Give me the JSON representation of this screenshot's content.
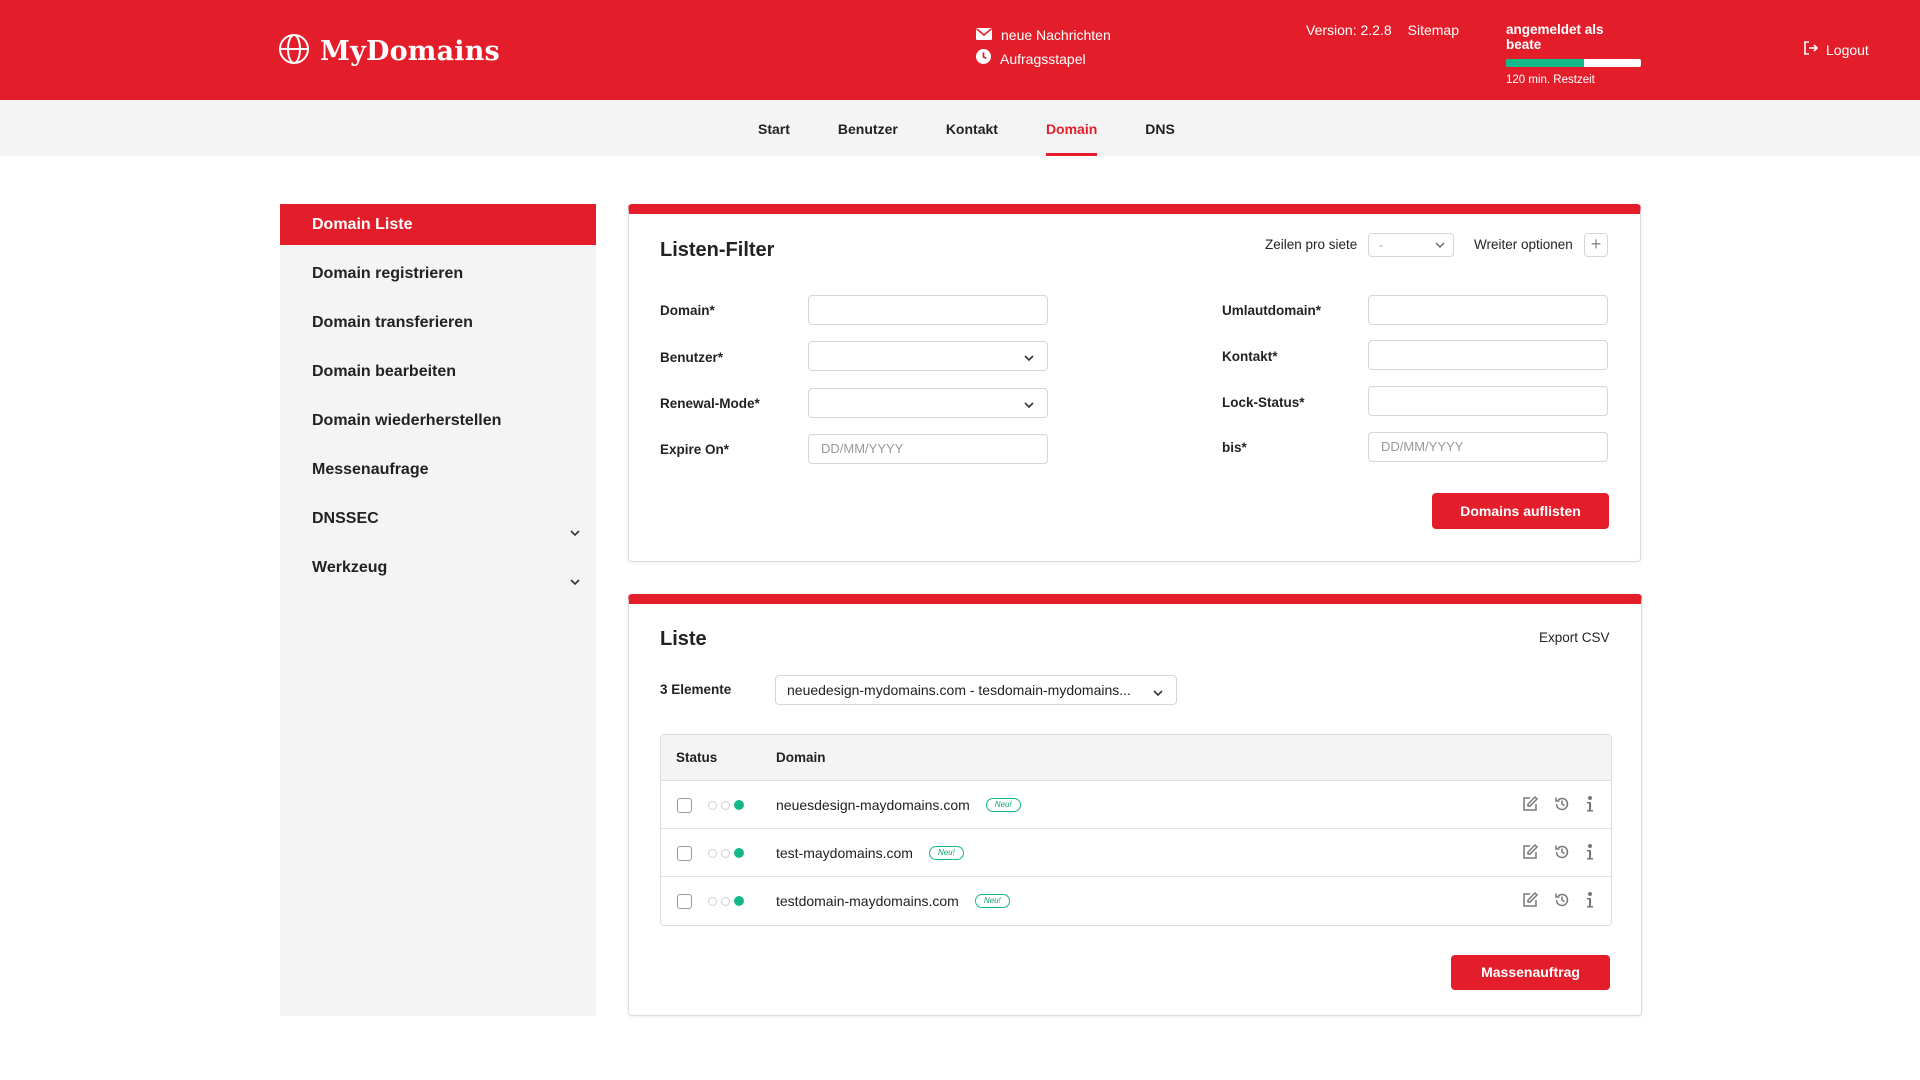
{
  "header": {
    "brand": "MyDomains",
    "links": [
      "neue Nachrichten",
      "Aufragsstapel"
    ],
    "version": "Version: 2.2.8",
    "sitemap": "Sitemap",
    "user": "angemeldet als beate",
    "session_fraction": 0.58,
    "session_rest": "120 min. Restzeit",
    "logout": "Logout",
    "accent": "#e31e2a",
    "progress_color": "#14b98a"
  },
  "nav": {
    "items": [
      "Start",
      "Benutzer",
      "Kontakt",
      "Domain",
      "DNS"
    ],
    "active": "Domain"
  },
  "sidebar": {
    "items": [
      "Domain Liste",
      "Domain registrieren",
      "Domain transferieren",
      "Domain bearbeiten",
      "Domain wiederherstellen",
      "Messenaufrage",
      "DNSSEC",
      "Werkzeug"
    ],
    "active": "Domain Liste"
  },
  "filter": {
    "title": "Listen-Filter",
    "rows_label": "Zeilen pro siete",
    "rows_value": "-",
    "more_options": "Wreiter optionen",
    "more_symbol": "+",
    "fields": {
      "domain": "Domain*",
      "benutzer": "Benutzer*",
      "renewal": "Renewal-Mode*",
      "expire": "Expire On*",
      "umlaut": "Umlautdomain*",
      "kontakt": "Kontakt*",
      "lock": "Lock-Status*",
      "bis": "bis*"
    },
    "date_placeholder": "DD/MM/YYYY",
    "submit": "Domains auflisten"
  },
  "list": {
    "title": "Liste",
    "export": "Export CSV",
    "count": "3 Elemente",
    "range": "neuedesign-mydomains.com - tesdomain-mydomains...",
    "columns": [
      "Status",
      "Domain"
    ],
    "rows": [
      {
        "domain": "neuesdesign-maydomains.com",
        "badge": "Neu!"
      },
      {
        "domain": "test-maydomains.com",
        "badge": "Neu!"
      },
      {
        "domain": "testdomain-maydomains.com",
        "badge": "Neu!"
      }
    ],
    "bulk_button": "Massenauftrag"
  }
}
